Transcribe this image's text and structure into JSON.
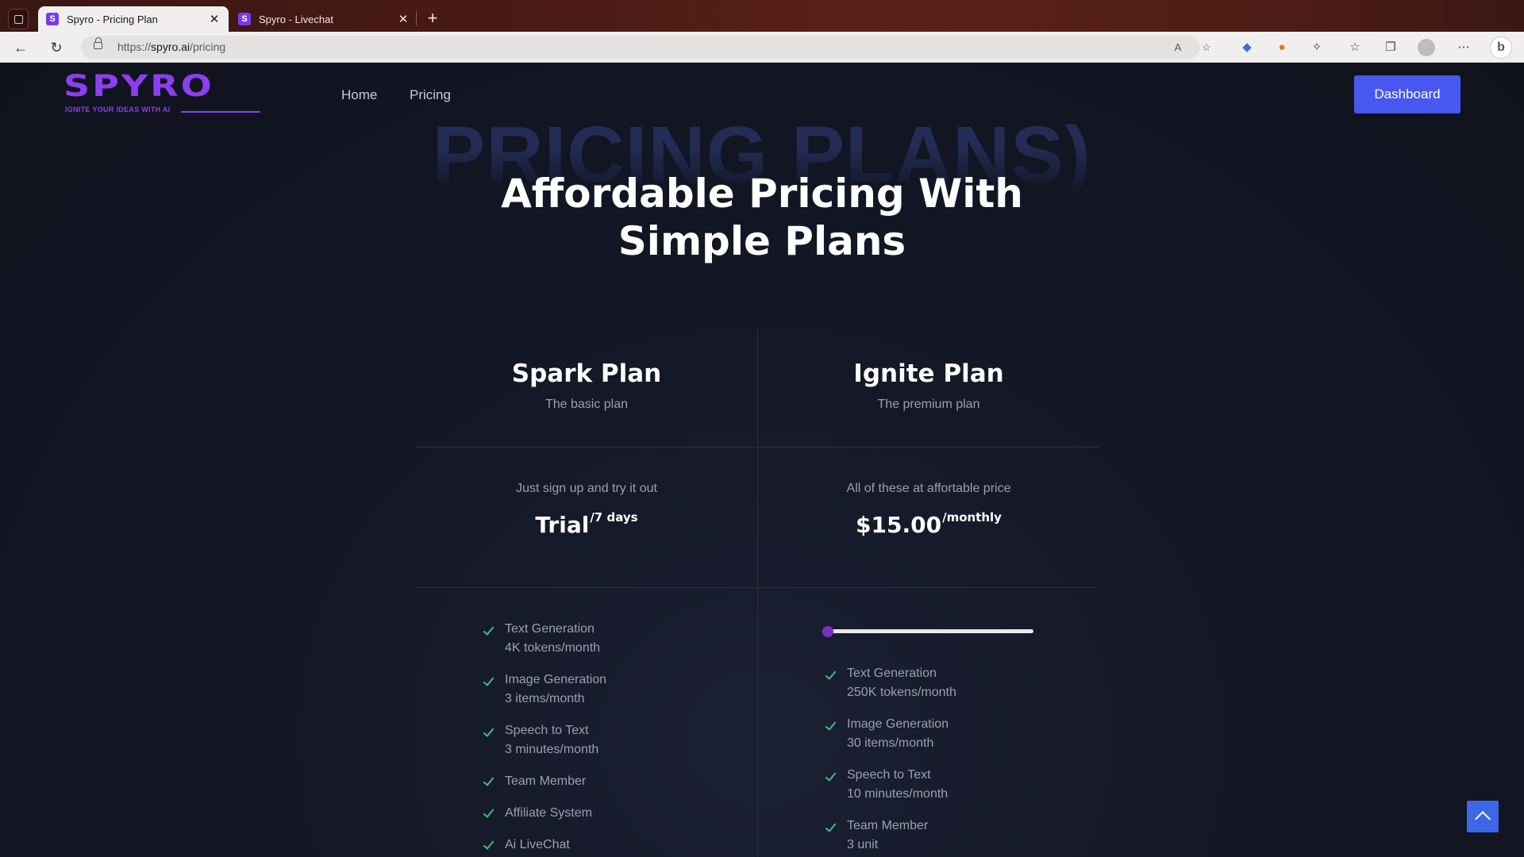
{
  "browser": {
    "tabs": [
      {
        "title": "Spyro - Pricing Plan",
        "favicon": "spyro-icon",
        "active": true
      },
      {
        "title": "Spyro - Livechat",
        "favicon": "spyro-icon",
        "active": false
      }
    ],
    "url_prefix": "https://",
    "url_domain": "spyro.ai",
    "url_path": "/pricing"
  },
  "site": {
    "logo_text": "SPYRO",
    "logo_tagline": "IGNITE YOUR IDEAS WITH AI",
    "brand_color": "#8b3ff0",
    "nav": [
      {
        "label": "Home"
      },
      {
        "label": "Pricing"
      }
    ],
    "dashboard_label": "Dashboard"
  },
  "hero": {
    "watermark": "PRICING PLANS)",
    "title_line1": "Affordable Pricing With",
    "title_line2": "Simple Plans"
  },
  "plans": [
    {
      "name": "Spark Plan",
      "subtitle": "The basic plan",
      "price_note": "Just sign up and try it out",
      "price": "Trial",
      "period": "/7 days",
      "features": [
        {
          "title": "Text Generation",
          "detail": "4K tokens/month"
        },
        {
          "title": "Image Generation",
          "detail": "3 items/month"
        },
        {
          "title": "Speech to Text",
          "detail": "3 minutes/month"
        },
        {
          "title": "Team Member",
          "detail": ""
        },
        {
          "title": "Affiliate System",
          "detail": ""
        },
        {
          "title": "Ai LiveChat",
          "detail": ""
        }
      ]
    },
    {
      "name": "Ignite Plan",
      "subtitle": "The premium plan",
      "price_note": "All of these at affortable price",
      "price": "$15.00",
      "period": "/monthly",
      "slider_value": 0,
      "features": [
        {
          "title": "Text Generation",
          "detail": "250K tokens/month"
        },
        {
          "title": "Image Generation",
          "detail": "30 items/month"
        },
        {
          "title": "Speech to Text",
          "detail": "10 minutes/month"
        },
        {
          "title": "Team Member",
          "detail": "3 unit"
        }
      ]
    }
  ],
  "colors": {
    "accent": "#4757f0",
    "check": "#3fbf7f",
    "slider_thumb": "#7b2fc2"
  }
}
